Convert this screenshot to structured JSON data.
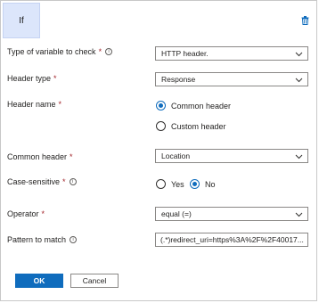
{
  "condition": {
    "title": "If",
    "delete_icon": "trash-icon"
  },
  "fields": {
    "variable_type": {
      "label": "Type of variable to check",
      "required": "*",
      "value": "HTTP header."
    },
    "header_type": {
      "label": "Header type",
      "required": "*",
      "value": "Response"
    },
    "header_name": {
      "label": "Header name",
      "required": "*",
      "options": [
        "Common header",
        "Custom header"
      ],
      "selected": "Common header"
    },
    "common_header": {
      "label": "Common header",
      "required": "*",
      "value": "Location"
    },
    "case_sensitive": {
      "label": "Case-sensitive",
      "required": "*",
      "options": [
        "Yes",
        "No"
      ],
      "selected": "No"
    },
    "operator": {
      "label": "Operator",
      "required": "*",
      "value": "equal (=)"
    },
    "pattern": {
      "label": "Pattern to match",
      "value": "(.*)redirect_uri=https%3A%2F%2F40017..."
    }
  },
  "buttons": {
    "ok": "OK",
    "cancel": "Cancel"
  },
  "colors": {
    "accent": "#0f6cbd",
    "required": "#a4262c",
    "tile_bg": "#dce6fb"
  }
}
